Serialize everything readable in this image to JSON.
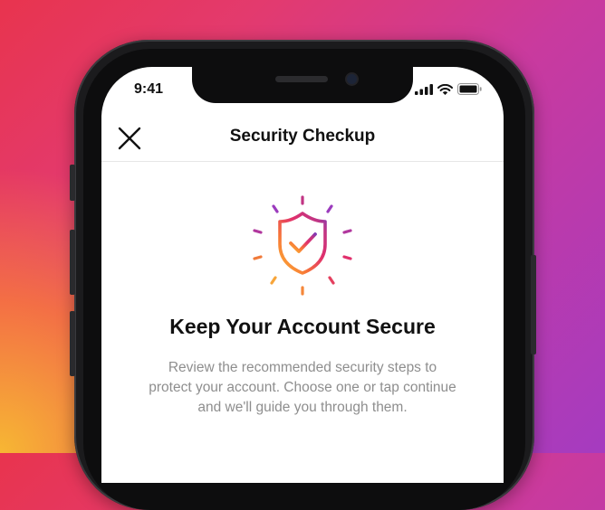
{
  "status_bar": {
    "time": "9:41",
    "icons": [
      "signal-icon",
      "wifi-icon",
      "battery-icon"
    ]
  },
  "header": {
    "title": "Security Checkup",
    "close_icon": "close-icon"
  },
  "main": {
    "illustration_icon": "shield-check-icon",
    "headline": "Keep Your Account Secure",
    "description": "Review the recommended security steps to protect your account. Choose one or tap continue and we'll guide you through them."
  },
  "colors": {
    "brand_gradient": [
      "#fdb536",
      "#f77737",
      "#e1306c",
      "#c13584",
      "#833ab4"
    ],
    "text_primary": "#111111",
    "text_secondary": "#8e8e8e"
  }
}
